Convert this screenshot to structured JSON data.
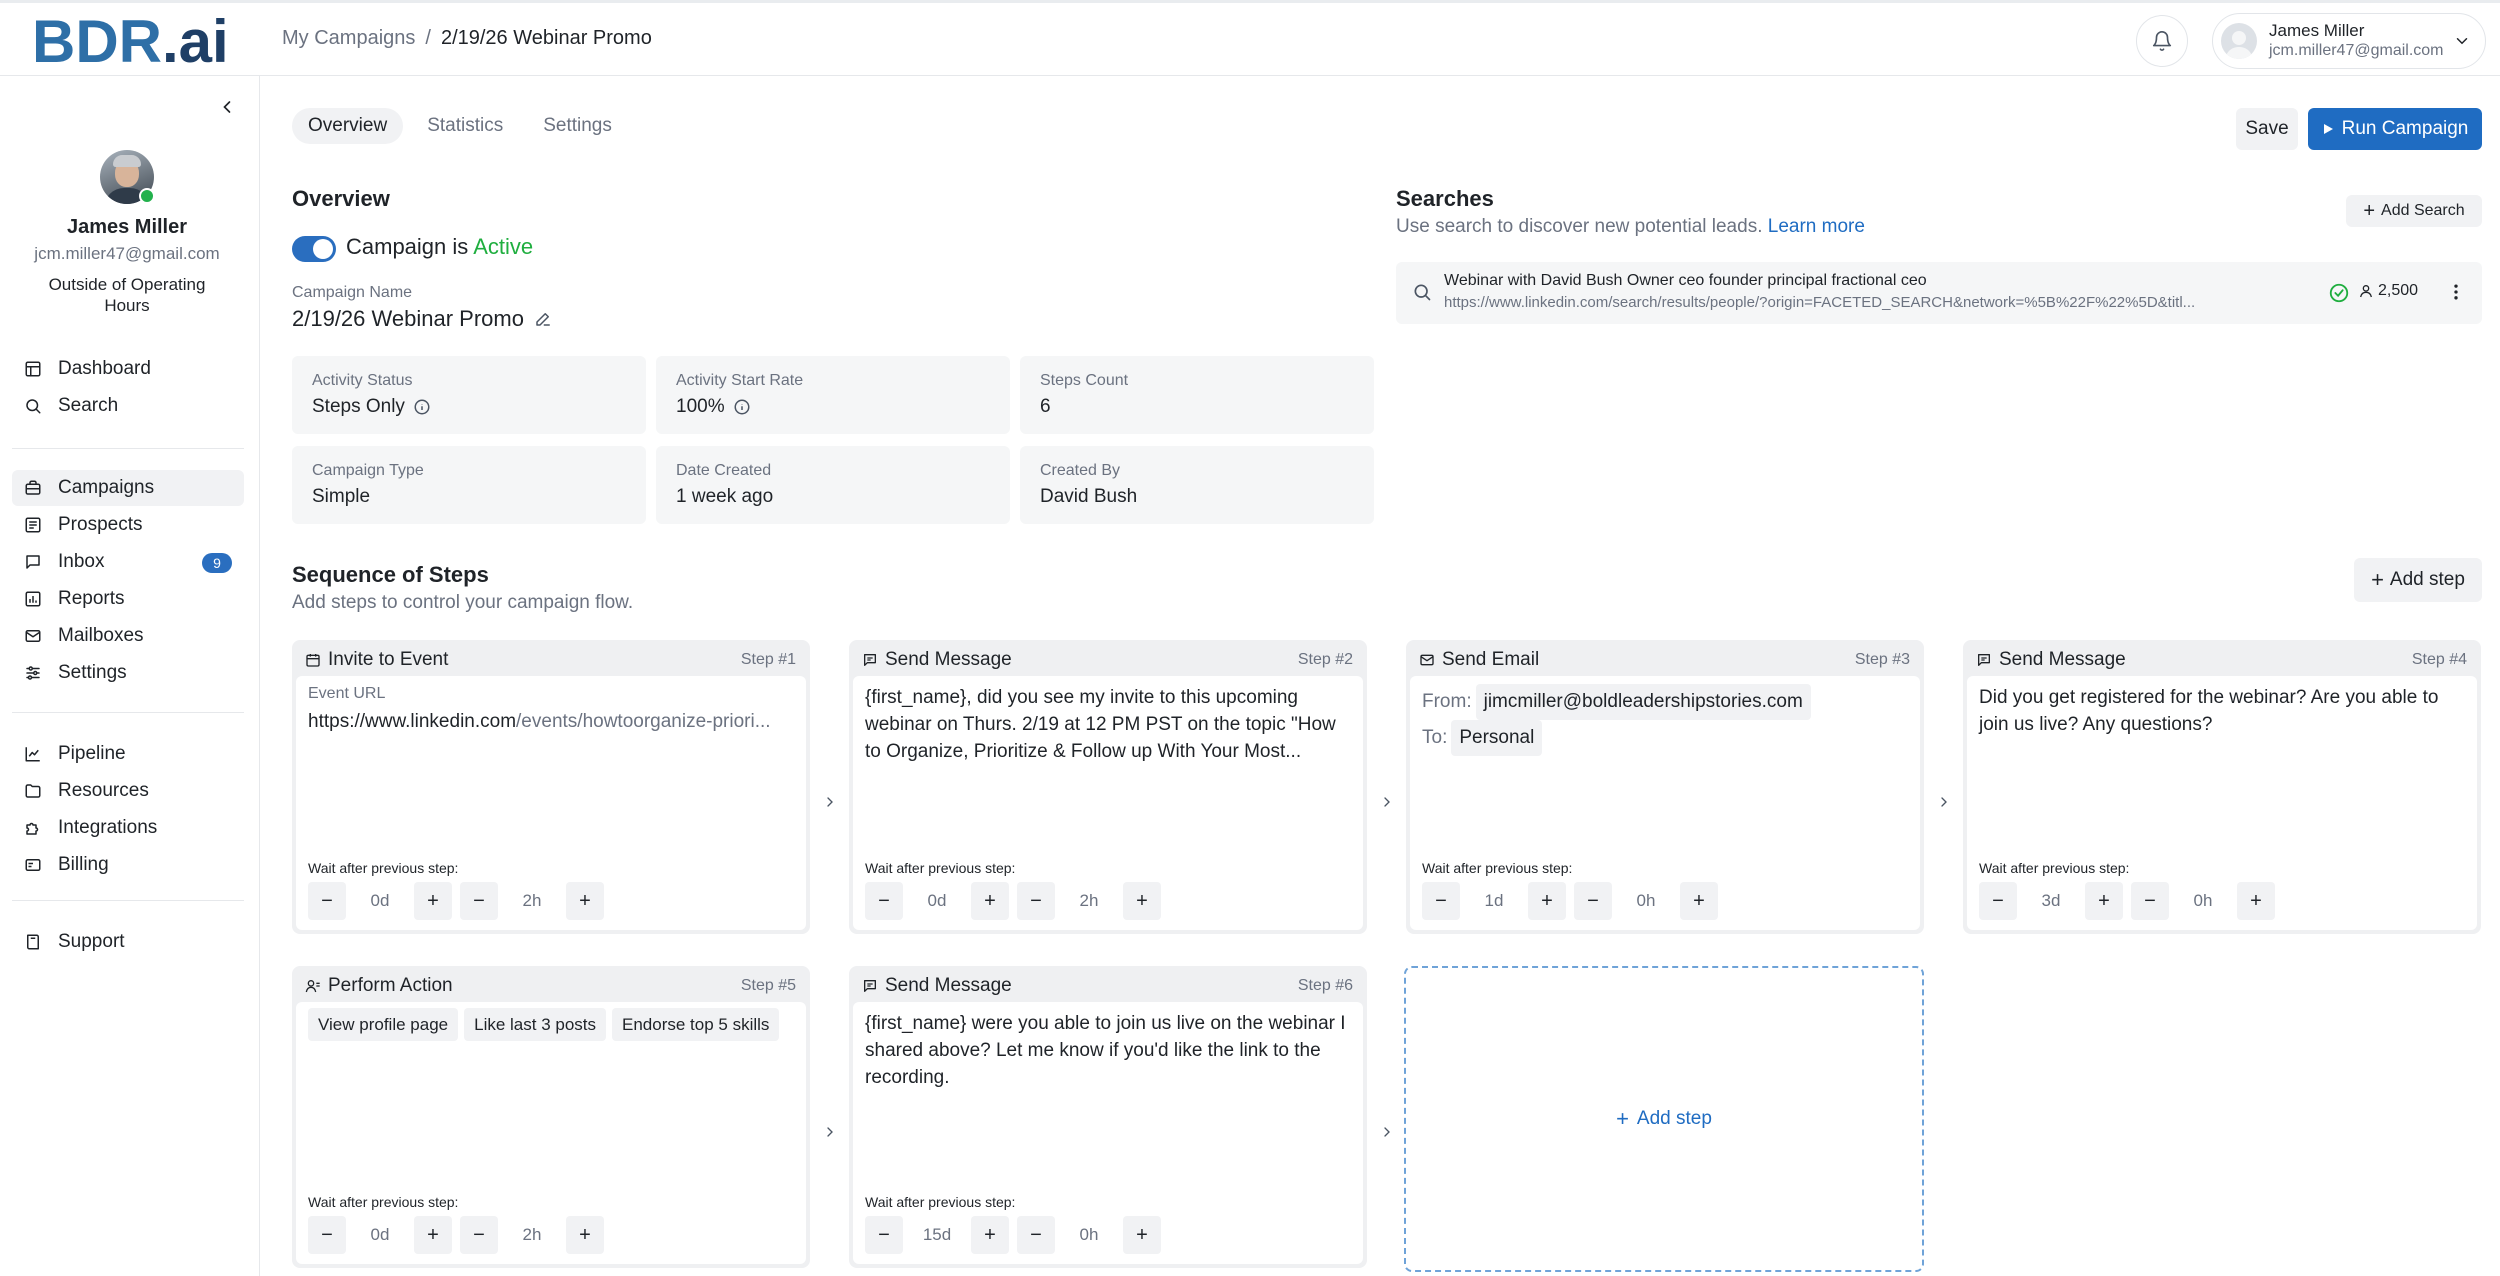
{
  "app": {
    "logo_left": "BDR",
    "logo_right": ".ai"
  },
  "breadcrumb": {
    "root": "My Campaigns",
    "sep": "/",
    "current": "2/19/26 Webinar Promo"
  },
  "user": {
    "name": "James Miller",
    "email": "jcm.miller47@gmail.com"
  },
  "sidebar": {
    "profile": {
      "name": "James Miller",
      "email": "jcm.miller47@gmail.com",
      "hours": "Outside of Operating Hours"
    },
    "group1": [
      {
        "label": "Dashboard",
        "icon": "dashboard-icon"
      },
      {
        "label": "Search",
        "icon": "search-icon"
      }
    ],
    "group2": [
      {
        "label": "Campaigns",
        "icon": "briefcase-icon"
      },
      {
        "label": "Prospects",
        "icon": "list-icon"
      },
      {
        "label": "Inbox",
        "icon": "chat-icon",
        "badge": "9"
      },
      {
        "label": "Reports",
        "icon": "bar-chart-icon"
      },
      {
        "label": "Mailboxes",
        "icon": "mail-icon"
      },
      {
        "label": "Settings",
        "icon": "sliders-icon"
      }
    ],
    "group3": [
      {
        "label": "Pipeline",
        "icon": "trend-icon"
      },
      {
        "label": "Resources",
        "icon": "folder-icon"
      },
      {
        "label": "Integrations",
        "icon": "puzzle-icon"
      },
      {
        "label": "Billing",
        "icon": "card-icon"
      }
    ],
    "group4": [
      {
        "label": "Support",
        "icon": "book-icon"
      }
    ]
  },
  "tabs": [
    {
      "label": "Overview"
    },
    {
      "label": "Statistics"
    },
    {
      "label": "Settings"
    }
  ],
  "actions": {
    "save": "Save",
    "run": "Run Campaign"
  },
  "overview": {
    "title": "Overview",
    "status_prefix": "Campaign is",
    "status_value": "Active",
    "name_label": "Campaign Name",
    "name_value": "2/19/26 Webinar Promo",
    "cards": [
      {
        "label": "Activity Status",
        "value": "Steps Only"
      },
      {
        "label": "Activity Start Rate",
        "value": "100%"
      },
      {
        "label": "Steps Count",
        "value": "6"
      },
      {
        "label": "Campaign Type",
        "value": "Simple"
      },
      {
        "label": "Date Created",
        "value": "1 week ago"
      },
      {
        "label": "Created By",
        "value": "David Bush"
      }
    ]
  },
  "searches": {
    "title": "Searches",
    "subtitle": "Use search to discover new potential leads.",
    "learn_more": "Learn more",
    "add_button": "Add Search",
    "item": {
      "title": "Webinar with David Bush Owner ceo founder principal fractional ceo",
      "url": "https://www.linkedin.com/search/results/people/?origin=FACETED_SEARCH&network=%5B%22F%22%5D&titl...",
      "count": "2,500"
    }
  },
  "sequence": {
    "title": "Sequence of Steps",
    "subtitle": "Add steps to control your campaign flow.",
    "add_button": "Add step",
    "wait_label": "Wait after previous step:",
    "add_card": "Add step",
    "steps": [
      {
        "type": "Invite to Event",
        "num": "Step #1",
        "field_label": "Event URL",
        "url_a": "https://www.linkedin.com",
        "url_b": "/events/howtoorganize-priori...",
        "days": "0d",
        "hours": "2h"
      },
      {
        "type": "Send Message",
        "num": "Step #2",
        "text": "{first_name}, did you see my invite to this upcoming webinar on Thurs. 2/19 at 12 PM PST on the topic \"How to Organize, Prioritize & Follow up With Your Most...",
        "days": "0d",
        "hours": "2h"
      },
      {
        "type": "Send Email",
        "num": "Step #3",
        "from_label": "From:",
        "from_value": "jimcmiller@boldleadershipstories.com",
        "to_label": "To:",
        "to_value": "Personal",
        "days": "1d",
        "hours": "0h"
      },
      {
        "type": "Send Message",
        "num": "Step #4",
        "text": "Did you get registered for the webinar? Are you able to join us live? Any questions?",
        "days": "3d",
        "hours": "0h"
      },
      {
        "type": "Perform Action",
        "num": "Step #5",
        "tags": [
          "View profile page",
          "Like last 3 posts",
          "Endorse top 5 skills"
        ],
        "days": "0d",
        "hours": "2h"
      },
      {
        "type": "Send Message",
        "num": "Step #6",
        "text": "{first_name} were you able to join us live on the webinar I shared above? Let me know if you'd like the link to the recording.",
        "days": "15d",
        "hours": "0h"
      }
    ]
  },
  "colors": {
    "accent": "#1f6cc2",
    "active_green": "#1fae3f",
    "logo_blue": "#2e6fa7",
    "logo_navy": "#1f3f66"
  }
}
